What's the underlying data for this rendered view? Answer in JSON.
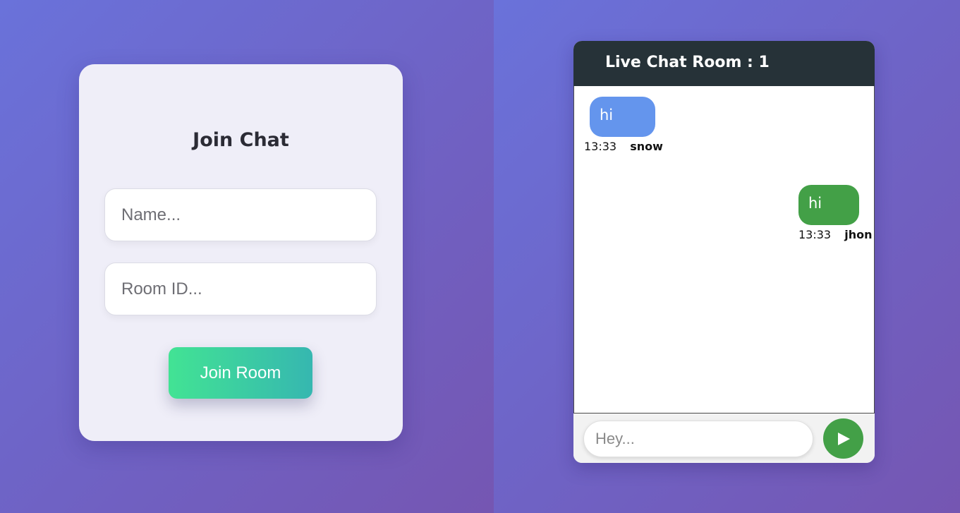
{
  "join": {
    "title": "Join Chat",
    "name_placeholder": "Name...",
    "room_placeholder": "Room ID...",
    "button_label": "Join Room"
  },
  "chat": {
    "title": "Live Chat Room : 1",
    "messages": [
      {
        "text": "hi",
        "time": "13:33",
        "author": "snow",
        "side": "other",
        "color": "#6495ed"
      },
      {
        "text": "hi",
        "time": "13:33",
        "author": "jhon",
        "side": "you",
        "color": "#43a047"
      }
    ],
    "input_placeholder": "Hey...",
    "send_icon": "play-send-icon"
  },
  "colors": {
    "header_bg": "#263238",
    "send_button": "#43a047",
    "join_gradient_start": "#42e394",
    "join_gradient_end": "#36b7b0"
  }
}
